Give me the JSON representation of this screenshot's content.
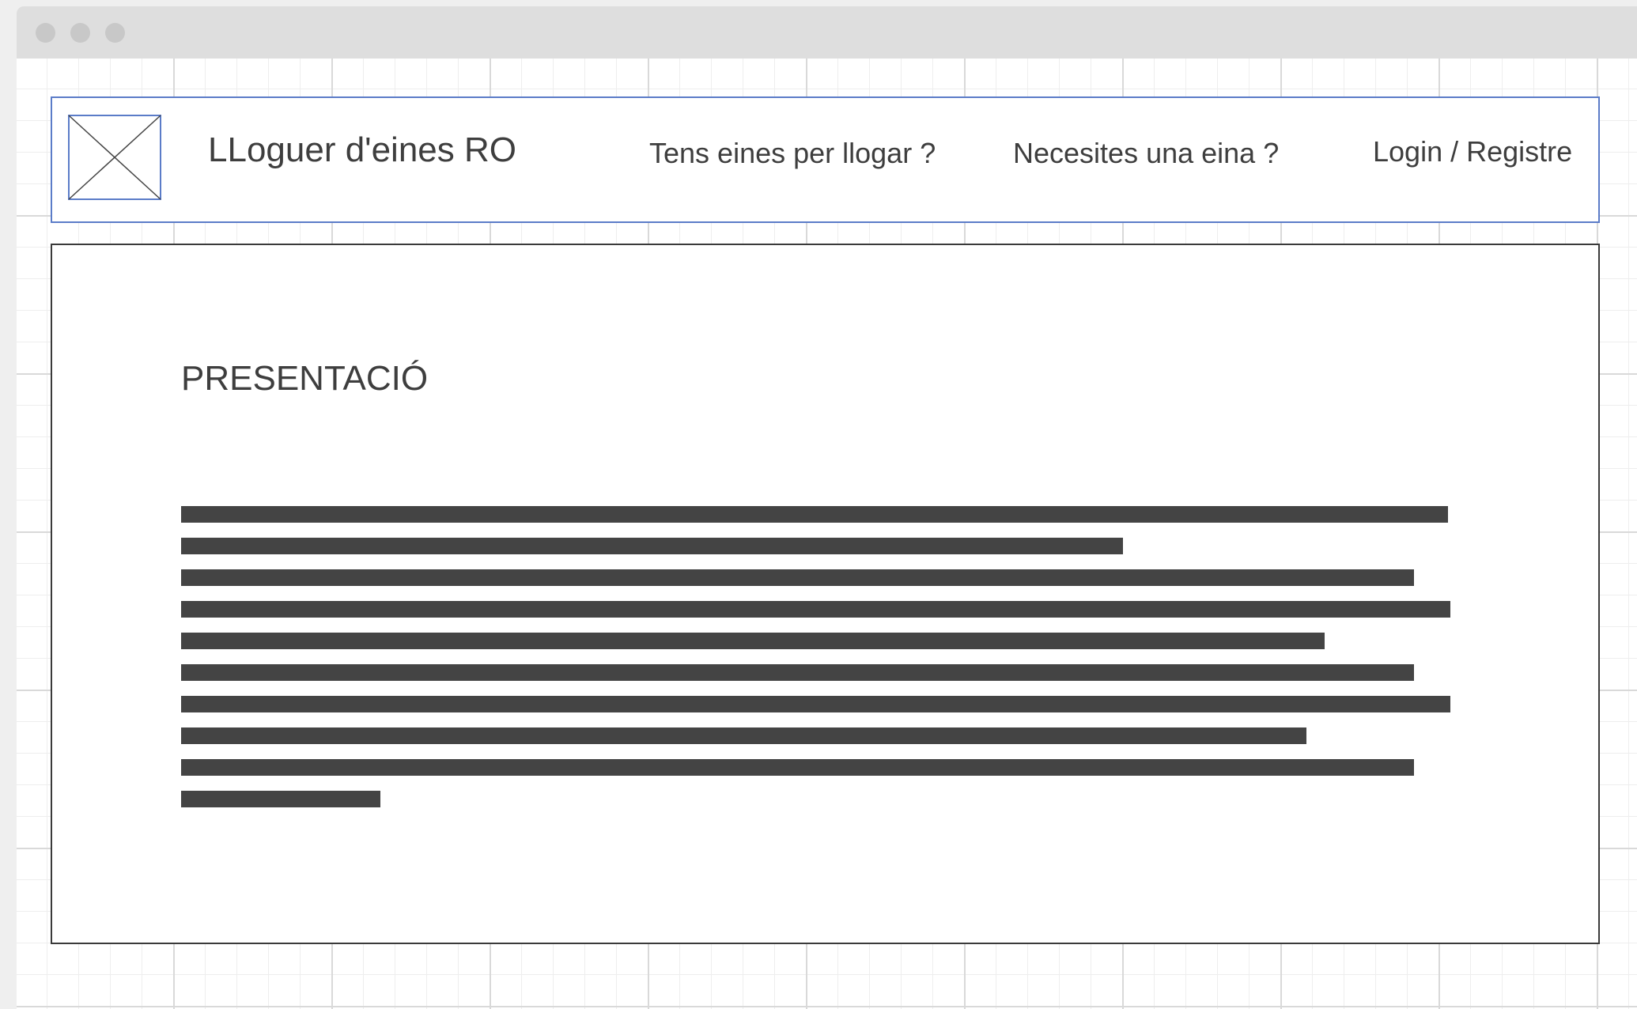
{
  "colors": {
    "header_border": "#5b7cc8",
    "content_border": "#3a3a3a",
    "text": "#3e3e3e",
    "placeholder_bar": "#444444",
    "titlebar": "#dedede",
    "grid_minor": "#eeeeee",
    "grid_major": "#d9d9d9"
  },
  "header": {
    "logo_icon": "image-placeholder-icon",
    "title": "LLoguer d'eines RO",
    "nav": {
      "rent_out": "Tens eines per llogar ?",
      "need_tool": "Necesites una eina ?",
      "login": "Login / Registre"
    }
  },
  "main": {
    "title": "PRESENTACIÓ"
  }
}
